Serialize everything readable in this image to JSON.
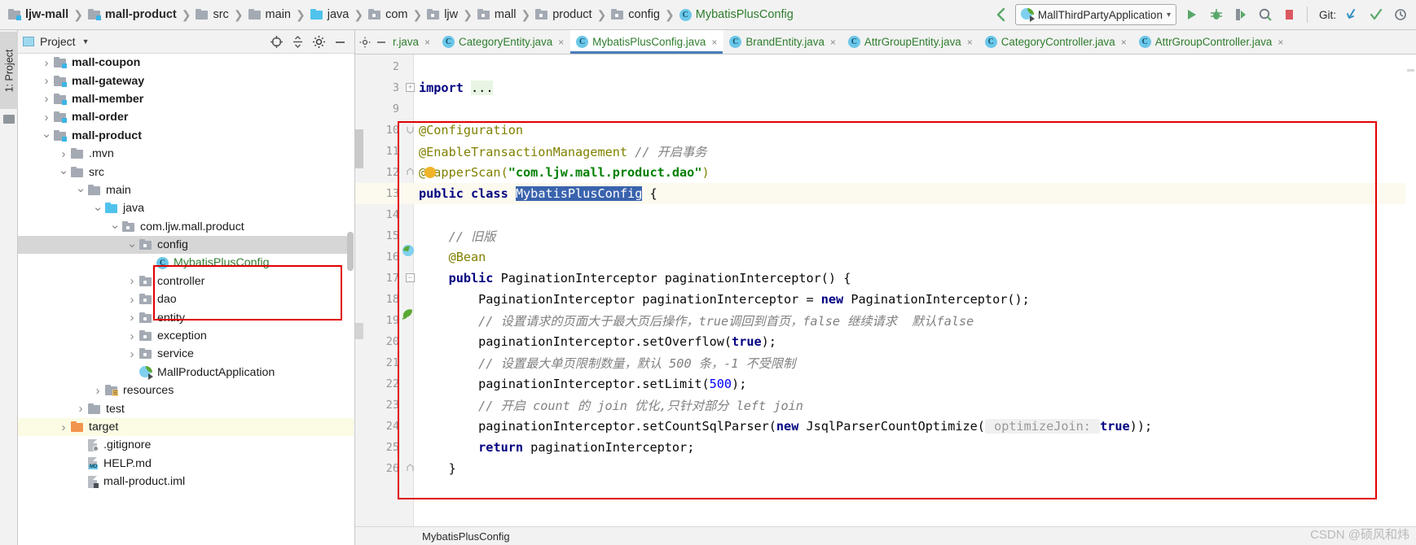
{
  "breadcrumbs": [
    {
      "label": "ljw-mall",
      "icon": "module-folder-icon",
      "bold": true,
      "type": "module"
    },
    {
      "label": "mall-product",
      "icon": "module-folder-icon",
      "bold": true,
      "type": "module"
    },
    {
      "label": "src",
      "icon": "folder-icon",
      "bold": false,
      "type": "folder"
    },
    {
      "label": "main",
      "icon": "folder-icon",
      "bold": false,
      "type": "folder"
    },
    {
      "label": "java",
      "icon": "source-folder-icon",
      "bold": false,
      "type": "source"
    },
    {
      "label": "com",
      "icon": "package-icon",
      "bold": false,
      "type": "package"
    },
    {
      "label": "ljw",
      "icon": "package-icon",
      "bold": false,
      "type": "package"
    },
    {
      "label": "mall",
      "icon": "package-icon",
      "bold": false,
      "type": "package"
    },
    {
      "label": "product",
      "icon": "package-icon",
      "bold": false,
      "type": "package"
    },
    {
      "label": "config",
      "icon": "package-icon",
      "bold": false,
      "type": "package"
    },
    {
      "label": "MybatisPlusConfig",
      "icon": "java-class-icon",
      "bold": false,
      "type": "class"
    }
  ],
  "toolbar": {
    "back_arrow_icon": "back-arrow-icon",
    "run_config": {
      "label": "MallThirdPartyApplication",
      "icon": "spring-boot-app-icon",
      "chevron": "chevron-down-icon"
    },
    "buttons": [
      {
        "name": "run-button",
        "icon": "run-icon"
      },
      {
        "name": "debug-button",
        "icon": "debug-icon"
      },
      {
        "name": "run-with-coverage-button",
        "icon": "coverage-icon"
      },
      {
        "name": "profile-button",
        "icon": "profiler-icon"
      },
      {
        "name": "stop-button",
        "icon": "stop-icon"
      }
    ],
    "git_label": "Git:",
    "git_buttons": [
      {
        "name": "update-project-button",
        "icon": "update-arrow-icon"
      },
      {
        "name": "commit-button",
        "icon": "checkmark-icon"
      }
    ]
  },
  "left_toolstrip": {
    "vertical_tab": "1: Project",
    "folder_icon": "folder-icon"
  },
  "project_panel": {
    "title": "Project",
    "chevron": "chevron-down-icon",
    "actions": [
      {
        "name": "locate-button",
        "icon": "crosshair-icon"
      },
      {
        "name": "collapse-all-button",
        "icon": "collapse-all-icon"
      },
      {
        "name": "settings-button",
        "icon": "gear-icon"
      },
      {
        "name": "hide-button",
        "icon": "minimize-icon"
      }
    ],
    "tree": [
      {
        "label": "mall-coupon",
        "depth": 1,
        "arrow": "right",
        "icon": "module-folder-icon",
        "bold": true,
        "state": "normal"
      },
      {
        "label": "mall-gateway",
        "depth": 1,
        "arrow": "right",
        "icon": "module-folder-icon",
        "bold": true,
        "state": "normal"
      },
      {
        "label": "mall-member",
        "depth": 1,
        "arrow": "right",
        "icon": "module-folder-icon",
        "bold": true,
        "state": "normal"
      },
      {
        "label": "mall-order",
        "depth": 1,
        "arrow": "right",
        "icon": "module-folder-icon",
        "bold": true,
        "state": "normal"
      },
      {
        "label": "mall-product",
        "depth": 1,
        "arrow": "down",
        "icon": "module-folder-icon",
        "bold": true,
        "state": "normal"
      },
      {
        "label": ".mvn",
        "depth": 2,
        "arrow": "right",
        "icon": "folder-icon",
        "bold": false,
        "state": "normal"
      },
      {
        "label": "src",
        "depth": 2,
        "arrow": "down",
        "icon": "folder-icon",
        "bold": false,
        "state": "normal"
      },
      {
        "label": "main",
        "depth": 3,
        "arrow": "down",
        "icon": "folder-icon",
        "bold": false,
        "state": "normal"
      },
      {
        "label": "java",
        "depth": 4,
        "arrow": "down",
        "icon": "source-folder-icon",
        "bold": false,
        "state": "normal"
      },
      {
        "label": "com.ljw.mall.product",
        "depth": 5,
        "arrow": "down",
        "icon": "package-icon",
        "bold": false,
        "state": "normal"
      },
      {
        "label": "config",
        "depth": 6,
        "arrow": "down",
        "icon": "package-icon",
        "bold": false,
        "state": "selected"
      },
      {
        "label": "MybatisPlusConfig",
        "depth": 7,
        "arrow": "none",
        "icon": "java-class-icon",
        "bold": false,
        "state": "green"
      },
      {
        "label": "controller",
        "depth": 6,
        "arrow": "right",
        "icon": "package-icon",
        "bold": false,
        "state": "normal"
      },
      {
        "label": "dao",
        "depth": 6,
        "arrow": "right",
        "icon": "package-icon",
        "bold": false,
        "state": "normal"
      },
      {
        "label": "entity",
        "depth": 6,
        "arrow": "right",
        "icon": "package-icon",
        "bold": false,
        "state": "normal"
      },
      {
        "label": "exception",
        "depth": 6,
        "arrow": "right",
        "icon": "package-icon",
        "bold": false,
        "state": "normal"
      },
      {
        "label": "service",
        "depth": 6,
        "arrow": "right",
        "icon": "package-icon",
        "bold": false,
        "state": "normal"
      },
      {
        "label": "MallProductApplication",
        "depth": 6,
        "arrow": "none",
        "icon": "spring-boot-app-icon",
        "bold": false,
        "state": "normal"
      },
      {
        "label": "resources",
        "depth": 4,
        "arrow": "right",
        "icon": "resources-folder-icon",
        "bold": false,
        "state": "normal"
      },
      {
        "label": "test",
        "depth": 3,
        "arrow": "right",
        "icon": "folder-icon",
        "bold": false,
        "state": "normal"
      },
      {
        "label": "target",
        "depth": 2,
        "arrow": "right",
        "icon": "excluded-folder-icon",
        "bold": false,
        "state": "highlight"
      },
      {
        "label": ".gitignore",
        "depth": 3,
        "arrow": "none",
        "icon": "gitignore-file-icon",
        "bold": false,
        "state": "normal"
      },
      {
        "label": "HELP.md",
        "depth": 3,
        "arrow": "none",
        "icon": "markdown-file-icon",
        "bold": false,
        "state": "normal"
      },
      {
        "label": "mall-product.iml",
        "depth": 3,
        "arrow": "none",
        "icon": "iml-file-icon",
        "bold": false,
        "state": "normal"
      }
    ]
  },
  "editor": {
    "tabs": [
      {
        "label": "r.java",
        "icon": "java-class-icon",
        "active": false,
        "partial": true,
        "close": "×"
      },
      {
        "label": "CategoryEntity.java",
        "icon": "java-class-icon",
        "active": false,
        "partial": false,
        "close": "×"
      },
      {
        "label": "MybatisPlusConfig.java",
        "icon": "java-class-icon",
        "active": true,
        "partial": false,
        "close": "×"
      },
      {
        "label": "BrandEntity.java",
        "icon": "java-class-icon",
        "active": false,
        "partial": false,
        "close": "×"
      },
      {
        "label": "AttrGroupEntity.java",
        "icon": "java-class-icon",
        "active": false,
        "partial": false,
        "close": "×"
      },
      {
        "label": "CategoryController.java",
        "icon": "java-class-icon",
        "active": false,
        "partial": false,
        "close": "×"
      },
      {
        "label": "AttrGroupController.java",
        "icon": "java-class-icon",
        "active": false,
        "partial": false,
        "close": "×"
      }
    ],
    "status_breadcrumb": "MybatisPlusConfig",
    "watermark": "CSDN @硕风和炜",
    "line_numbers": [
      2,
      3,
      9,
      10,
      11,
      12,
      13,
      14,
      15,
      16,
      17,
      18,
      19,
      20,
      21,
      22,
      23,
      24,
      25,
      26
    ],
    "lines": [
      {
        "num": 2,
        "text": "",
        "current": false
      },
      {
        "num": 3,
        "text": "import ...",
        "current": false
      },
      {
        "num": 9,
        "text": "",
        "current": false
      },
      {
        "num": 10,
        "text": "@Configuration",
        "current": false
      },
      {
        "num": 11,
        "text": "@EnableTransactionManagement // 开启事务",
        "current": false
      },
      {
        "num": 12,
        "text": "@MapperScan(\"com.ljw.mall.product.dao\")",
        "current": false
      },
      {
        "num": 13,
        "text": "public class MybatisPlusConfig {",
        "current": true
      },
      {
        "num": 14,
        "text": "",
        "current": false
      },
      {
        "num": 15,
        "text": "    // 旧版",
        "current": false
      },
      {
        "num": 16,
        "text": "    @Bean",
        "current": false
      },
      {
        "num": 17,
        "text": "    public PaginationInterceptor paginationInterceptor() {",
        "current": false
      },
      {
        "num": 18,
        "text": "        PaginationInterceptor paginationInterceptor = new PaginationInterceptor();",
        "current": false
      },
      {
        "num": 19,
        "text": "        // 设置请求的页面大于最大页后操作，true调回到首页，false 继续请求  默认false",
        "current": false
      },
      {
        "num": 20,
        "text": "        paginationInterceptor.setOverflow(true);",
        "current": false
      },
      {
        "num": 21,
        "text": "        // 设置最大单页限制数量，默认 500 条，-1 不受限制",
        "current": false
      },
      {
        "num": 22,
        "text": "        paginationInterceptor.setLimit(500);",
        "current": false
      },
      {
        "num": 23,
        "text": "        // 开启 count 的 join 优化,只针对部分 left join",
        "current": false
      },
      {
        "num": 24,
        "text": "        paginationInterceptor.setCountSqlParser(new JsqlParserCountOptimize( optimizeJoin: true));",
        "current": false
      },
      {
        "num": 25,
        "text": "        return paginationInterceptor;",
        "current": false
      },
      {
        "num": 26,
        "text": "    }",
        "current": false
      }
    ],
    "selected_token": "MybatisPlusConfig",
    "param_hint": "optimizeJoin:"
  },
  "colors": {
    "annotation_red": "#e00000",
    "keyword_blue": "#000080",
    "string_green": "#008000",
    "annotation_olive": "#808000",
    "comment_gray": "#808080",
    "number_blue": "#0000ff",
    "selection_blue": "#3a63ad",
    "active_tab_underline": "#4a7ebb",
    "highlight_yellow": "#fcfbe3"
  }
}
